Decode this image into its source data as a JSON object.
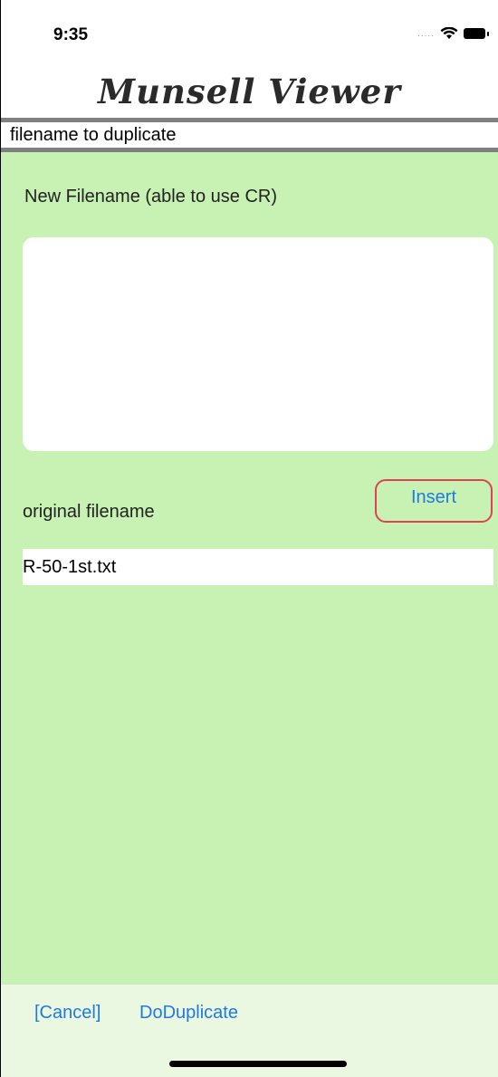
{
  "status_bar": {
    "time": "9:35",
    "signal_dots": "....."
  },
  "app": {
    "title": "Munsell Viewer"
  },
  "subheader": {
    "text": "filename to duplicate"
  },
  "form": {
    "new_filename_label": "New Filename (able to use CR)",
    "new_filename_value": "",
    "original_label": "original filename",
    "insert_label": "Insert",
    "original_value": "R-50-1st.txt"
  },
  "toolbar": {
    "cancel_label": "[Cancel]",
    "duplicate_label": "DoDuplicate"
  },
  "colors": {
    "content_background": "#c8f2b4",
    "accent_blue": "#1e7ae0",
    "insert_border": "#e04050"
  }
}
